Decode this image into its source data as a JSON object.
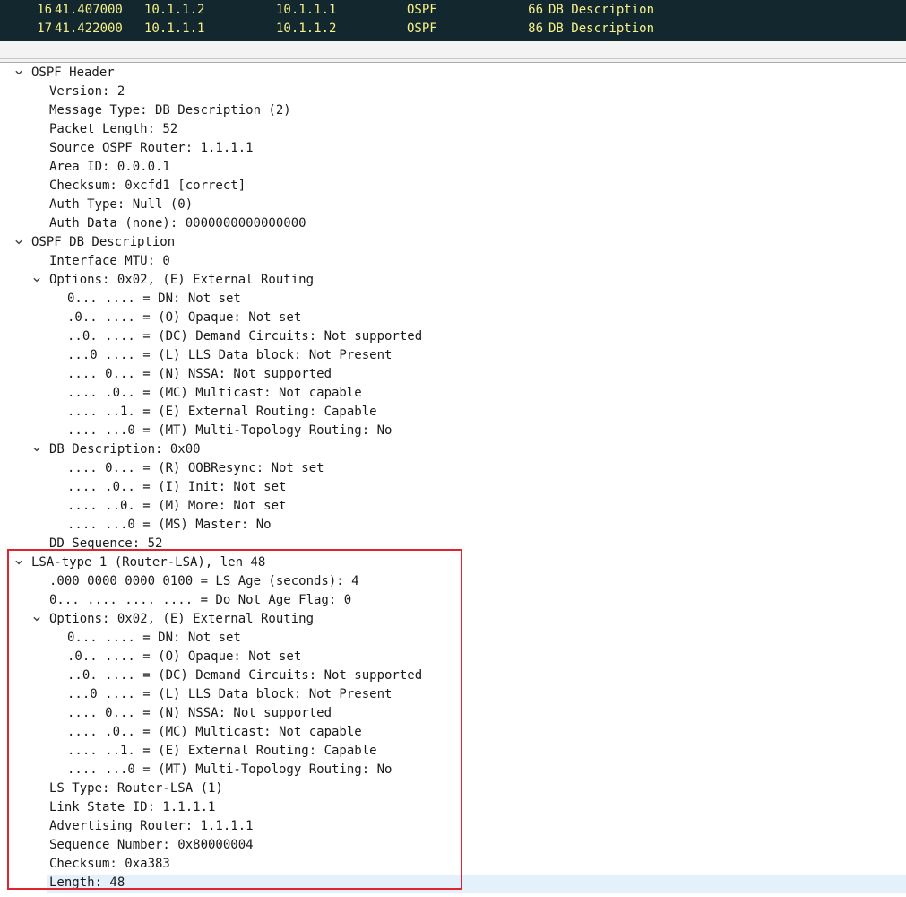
{
  "packet_list": [
    {
      "no": "16",
      "time": "41.407000",
      "source": "10.1.1.2",
      "destination": "10.1.1.1",
      "protocol": "OSPF",
      "length": "66",
      "info": "DB Description"
    },
    {
      "no": "17",
      "time": "41.422000",
      "source": "10.1.1.1",
      "destination": "10.1.1.2",
      "protocol": "OSPF",
      "length": "86",
      "info": "DB Description"
    }
  ],
  "details": [
    {
      "text": "OSPF Header",
      "expanded": true
    },
    {
      "text": "Version: 2"
    },
    {
      "text": "Message Type: DB Description (2)"
    },
    {
      "text": "Packet Length: 52"
    },
    {
      "text": "Source OSPF Router: 1.1.1.1"
    },
    {
      "text": "Area ID: 0.0.0.1"
    },
    {
      "text": "Checksum: 0xcfd1 [correct]"
    },
    {
      "text": "Auth Type: Null (0)"
    },
    {
      "text": "Auth Data (none): 0000000000000000"
    },
    {
      "text": "OSPF DB Description",
      "expanded": true
    },
    {
      "text": "Interface MTU: 0"
    },
    {
      "text": "Options: 0x02, (E) External Routing",
      "expanded": true
    },
    {
      "text": "0... .... = DN: Not set"
    },
    {
      "text": ".0.. .... = (O) Opaque: Not set"
    },
    {
      "text": "..0. .... = (DC) Demand Circuits: Not supported"
    },
    {
      "text": "...0 .... = (L) LLS Data block: Not Present"
    },
    {
      "text": ".... 0... = (N) NSSA: Not supported"
    },
    {
      "text": ".... .0.. = (MC) Multicast: Not capable"
    },
    {
      "text": ".... ..1. = (E) External Routing: Capable"
    },
    {
      "text": ".... ...0 = (MT) Multi-Topology Routing: No"
    },
    {
      "text": "DB Description: 0x00",
      "expanded": true
    },
    {
      "text": ".... 0... = (R) OOBResync: Not set"
    },
    {
      "text": ".... .0.. = (I) Init: Not set"
    },
    {
      "text": ".... ..0. = (M) More: Not set"
    },
    {
      "text": ".... ...0 = (MS) Master: No"
    },
    {
      "text": "DD Sequence: 52"
    },
    {
      "text": "LSA-type 1 (Router-LSA), len 48",
      "expanded": true
    },
    {
      "text": ".000 0000 0000 0100 = LS Age (seconds): 4"
    },
    {
      "text": "0... .... .... .... = Do Not Age Flag: 0"
    },
    {
      "text": "Options: 0x02, (E) External Routing",
      "expanded": true
    },
    {
      "text": "0... .... = DN: Not set"
    },
    {
      "text": ".0.. .... = (O) Opaque: Not set"
    },
    {
      "text": "..0. .... = (DC) Demand Circuits: Not supported"
    },
    {
      "text": "...0 .... = (L) LLS Data block: Not Present"
    },
    {
      "text": ".... 0... = (N) NSSA: Not supported"
    },
    {
      "text": ".... .0.. = (MC) Multicast: Not capable"
    },
    {
      "text": ".... ..1. = (E) External Routing: Capable"
    },
    {
      "text": ".... ...0 = (MT) Multi-Topology Routing: No"
    },
    {
      "text": "LS Type: Router-LSA (1)"
    },
    {
      "text": "Link State ID: 1.1.1.1"
    },
    {
      "text": "Advertising Router: 1.1.1.1"
    },
    {
      "text": "Sequence Number: 0x80000004"
    },
    {
      "text": "Checksum: 0xa383"
    },
    {
      "text": "Length: 48",
      "selected": true
    }
  ],
  "colors": {
    "packet_list_bg": "#12272e",
    "packet_list_text": "#f7f08a",
    "selection_bg": "#e4f0fb",
    "highlight_border": "#e0232d"
  },
  "icons": {
    "expander": "chevron-down-icon"
  }
}
